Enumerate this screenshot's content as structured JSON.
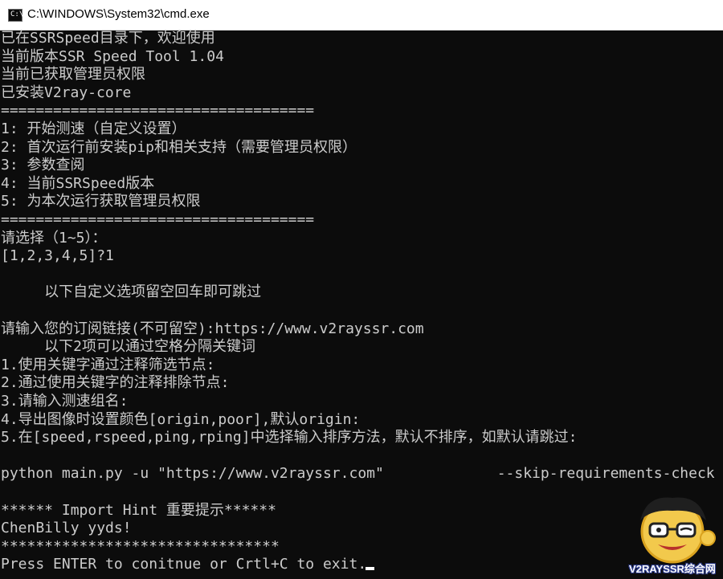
{
  "window": {
    "title": "C:\\WINDOWS\\System32\\cmd.exe",
    "icon": "cmd-icon",
    "icon_glyph": "C:\\"
  },
  "console": {
    "lines": [
      "已在SSRSpeed目录下，欢迎使用",
      "当前版本SSR Speed Tool 1.04",
      "当前已获取管理员权限",
      "已安装V2ray-core",
      "====================================",
      "1: 开始测速（自定义设置）",
      "2: 首次运行前安装pip和相关支持（需要管理员权限）",
      "3: 参数查阅",
      "4: 当前SSRSpeed版本",
      "5: 为本次运行获取管理员权限",
      "====================================",
      "请选择（1~5）：",
      "[1,2,3,4,5]?1",
      "",
      "     以下自定义选项留空回车即可跳过",
      "",
      "请输入您的订阅链接(不可留空):https://www.v2rayssr.com",
      "     以下2项可以通过空格分隔关键词",
      "1.使用关键字通过注释筛选节点:",
      "2.通过使用关键字的注释排除节点:",
      "3.请输入测速组名:",
      "4.导出图像时设置颜色[origin,poor],默认origin:",
      "5.在[speed,rspeed,ping,rping]中选择输入排序方法，默认不排序，如默认请跳过:",
      "",
      "python main.py -u \"https://www.v2rayssr.com\"             --skip-requirements-check",
      "",
      "****** Import Hint 重要提示******",
      "ChenBilly yyds!",
      "********************************",
      "Press ENTER to conitnue or Crtl+C to exit."
    ]
  },
  "watermark": {
    "text": "V2RAYSSR综合网"
  },
  "colors": {
    "console_bg": "#0c0c0c",
    "console_fg": "#cccccc",
    "titlebar_bg": "#ffffff"
  }
}
